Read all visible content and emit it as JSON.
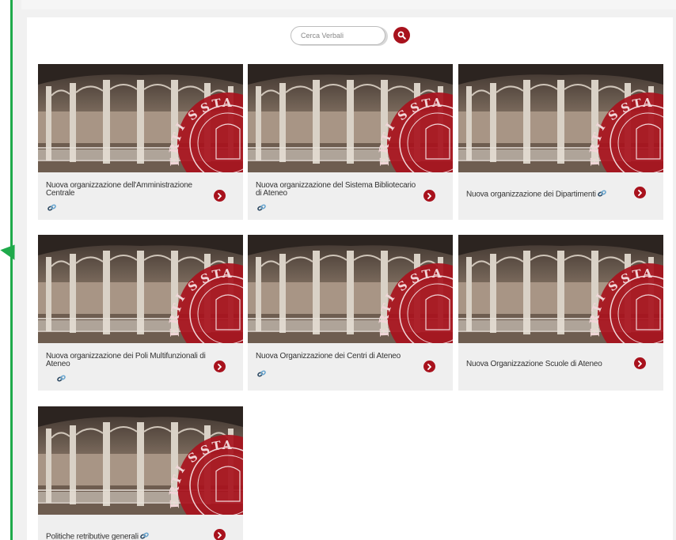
{
  "search": {
    "placeholder": "Cerca Verbali"
  },
  "colors": {
    "accent": "#a8121d",
    "guide": "#1faa4b"
  },
  "icons": {
    "search": "search-icon",
    "arrow": "chevron-right-icon",
    "link": "link-icon"
  },
  "cards": [
    {
      "title": "Nuova organizzazione dell'Amministrazione Centrale",
      "has_link": true
    },
    {
      "title": "Nuova organizzazione del Sistema Bibliotecario di Ateneo",
      "has_link": true
    },
    {
      "title": "Nuova organizzazione dei Dipartimenti",
      "has_link": true
    },
    {
      "title": "Nuova organizzazione dei Poli Multifunzionali di Ateneo",
      "has_link": true
    },
    {
      "title": "Nuova Organizzazione dei Centri di Ateneo",
      "has_link": true
    },
    {
      "title": "Nuova Organizzazione Scuole di Ateneo",
      "has_link": false
    },
    {
      "title": "Politiche retributive generali",
      "has_link": true
    }
  ]
}
